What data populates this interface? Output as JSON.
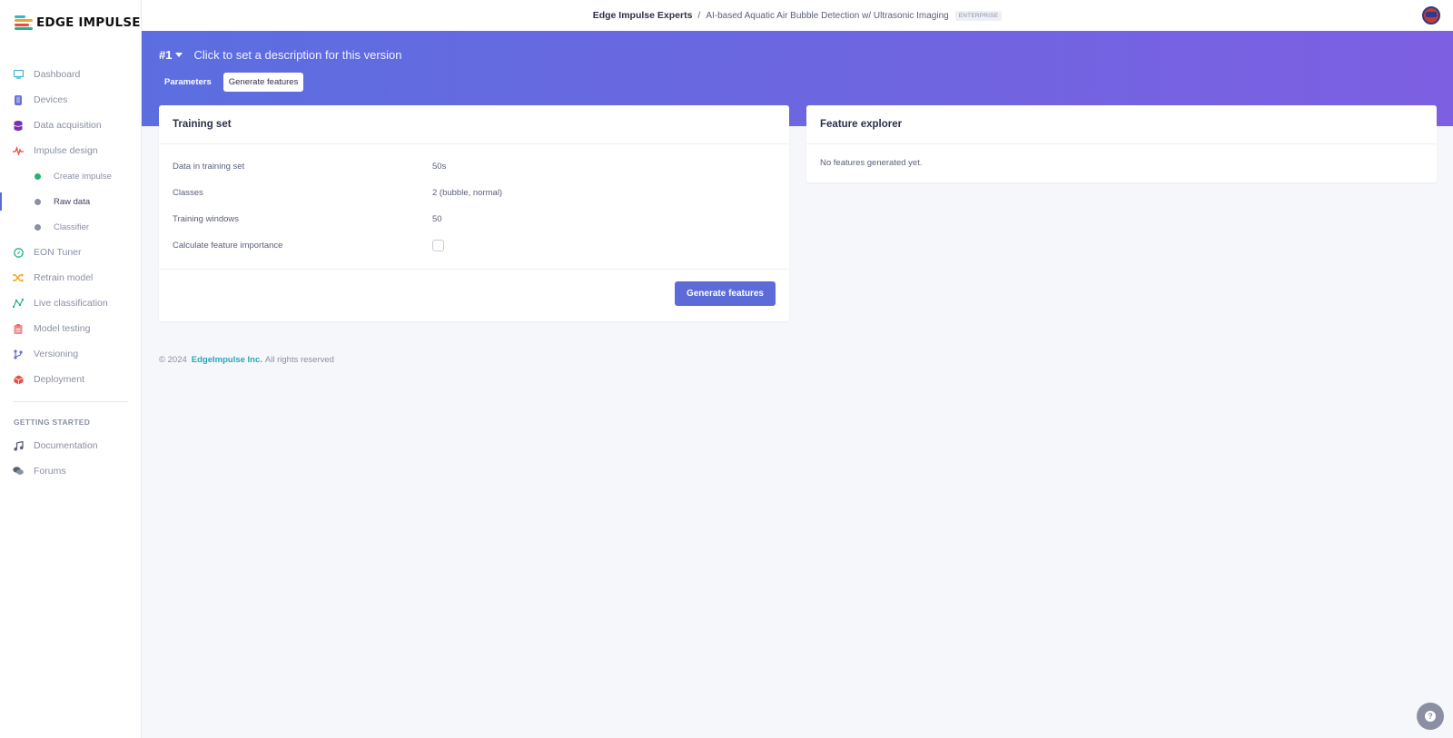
{
  "brand": {
    "name": "EDGE IMPULSE",
    "logo_colors": [
      "#3bb4c7",
      "#f4a423",
      "#e94d3f",
      "#25b48a"
    ]
  },
  "topbar": {
    "org": "Edge Impulse Experts",
    "separator": "/",
    "project": "AI-based Aquatic Air Bubble Detection w/ Ultrasonic Imaging",
    "badge": "ENTERPRISE"
  },
  "sidebar": {
    "items": [
      {
        "label": "Dashboard",
        "icon": "monitor-icon",
        "color": "#3bb4c7"
      },
      {
        "label": "Devices",
        "icon": "devices-icon",
        "color": "#6a6fd8"
      },
      {
        "label": "Data acquisition",
        "icon": "database-icon",
        "color": "#7a2fb0"
      },
      {
        "label": "Impulse design",
        "icon": "pulse-icon",
        "color": "#e94d3f"
      }
    ],
    "sub_items": [
      {
        "label": "Create impulse",
        "dot_color": "#25b46a"
      },
      {
        "label": "Raw data",
        "dot_color": "#8a8fa3"
      },
      {
        "label": "Classifier",
        "dot_color": "#8a8fa3"
      }
    ],
    "items_after": [
      {
        "label": "EON Tuner",
        "icon": "compass-icon",
        "color": "#25b48a"
      },
      {
        "label": "Retrain model",
        "icon": "shuffle-icon",
        "color": "#f4a423"
      },
      {
        "label": "Live classification",
        "icon": "graph-icon",
        "color": "#25b48a"
      },
      {
        "label": "Model testing",
        "icon": "clipboard-icon",
        "color": "#f08a8a"
      },
      {
        "label": "Versioning",
        "icon": "branch-icon",
        "color": "#6a6fd8"
      },
      {
        "label": "Deployment",
        "icon": "cube-icon",
        "color": "#e94d3f"
      }
    ],
    "section_title": "GETTING STARTED",
    "getting_started": [
      {
        "label": "Documentation",
        "icon": "music-icon",
        "color": "#5b607a"
      },
      {
        "label": "Forums",
        "icon": "chat-icon",
        "color": "#5b607a"
      }
    ]
  },
  "header": {
    "version": "#1",
    "description": "Click to set a description for this version",
    "tabs": [
      {
        "label": "Parameters",
        "active": false
      },
      {
        "label": "Generate features",
        "active": true
      }
    ]
  },
  "training_set": {
    "title": "Training set",
    "rows": [
      {
        "key": "Data in training set",
        "value": "50s"
      },
      {
        "key": "Classes",
        "value": "2 (bubble, normal)"
      },
      {
        "key": "Training windows",
        "value": "50"
      }
    ],
    "importance_label": "Calculate feature importance",
    "importance_checked": false,
    "button": "Generate features"
  },
  "feature_explorer": {
    "title": "Feature explorer",
    "empty_text": "No features generated yet."
  },
  "footer": {
    "copyright": "© 2024",
    "company": "EdgeImpulse Inc.",
    "rights": "All rights reserved"
  },
  "help_glyph": "?"
}
